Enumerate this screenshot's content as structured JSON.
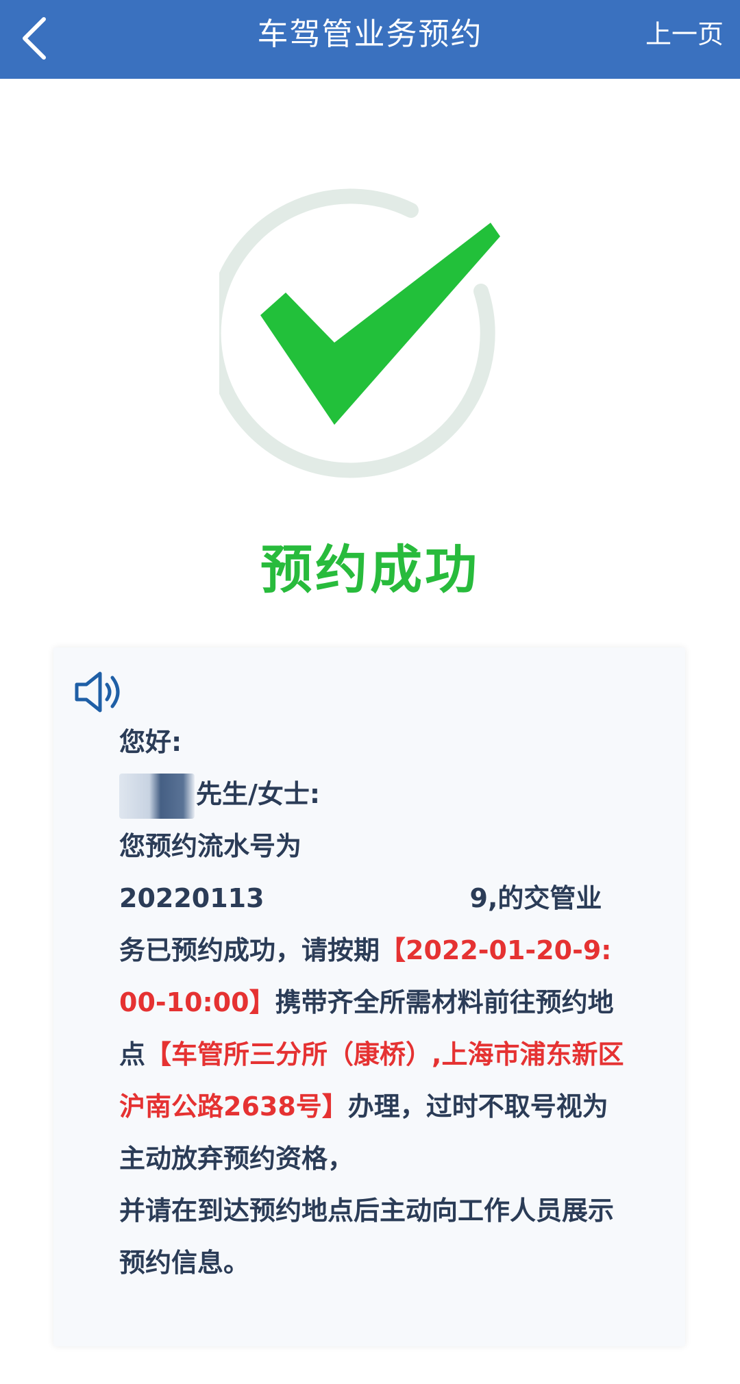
{
  "header": {
    "title": "车驾管业务预约",
    "prev_label": "上一页",
    "background": "#3a71bf"
  },
  "status": {
    "text": "预约成功",
    "color": "#28bb3c",
    "icon": "check-circle-icon"
  },
  "message": {
    "greeting": "您好:",
    "salutation": "先生/女士:",
    "serial_intro": "您预约流水号为",
    "serial_start": "20220113",
    "serial_end": "9",
    "after_serial": ",的交管业务已预约成功，请按期",
    "time": "【2022-01-20-9:00-10:00】",
    "after_time": "携带齐全所需材料前往预约地点",
    "location": "【车管所三分所（康桥）,上海市浦东新区沪南公路2638号】",
    "after_location": "办理，过时不取号视为主动放弃预约资格，",
    "closing": "并请在到达预约地点后主动向工作人员展示预约信息。",
    "text_color": "#2b3c57",
    "highlight_color": "#e53232"
  },
  "icons": {
    "back": "chevron-left-icon",
    "speaker": "speaker-icon"
  }
}
